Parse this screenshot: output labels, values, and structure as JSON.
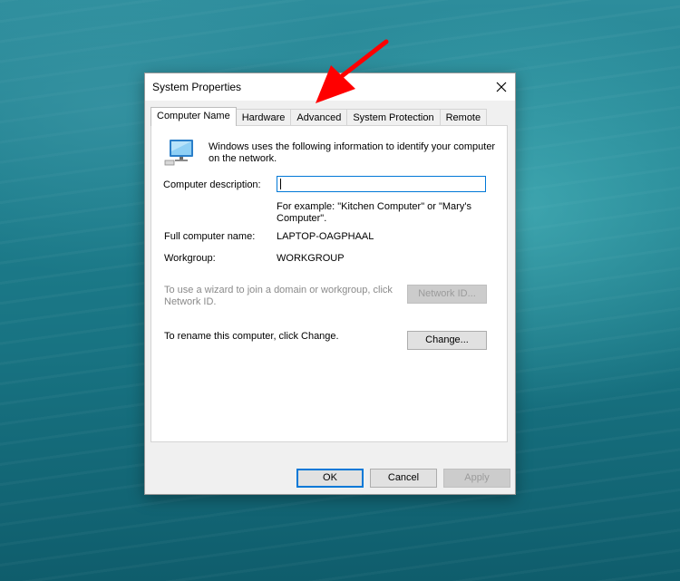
{
  "window": {
    "title": "System Properties"
  },
  "tabs": [
    {
      "label": "Computer Name",
      "active": true
    },
    {
      "label": "Hardware",
      "active": false
    },
    {
      "label": "Advanced",
      "active": false
    },
    {
      "label": "System Protection",
      "active": false
    },
    {
      "label": "Remote",
      "active": false
    }
  ],
  "computer_name_tab": {
    "intro_line1": "Windows uses the following information to identify your computer",
    "intro_line2": "on the network.",
    "description_label": "Computer description:",
    "description_value": "",
    "example_line1": "For example: \"Kitchen Computer\" or \"Mary's",
    "example_line2": "Computer\".",
    "full_name_label": "Full computer name:",
    "full_name_value": "LAPTOP-OAGPHAAL",
    "workgroup_label": "Workgroup:",
    "workgroup_value": "WORKGROUP",
    "wizard_line1": "To use a wizard to join a domain or workgroup, click",
    "wizard_line2": "Network ID.",
    "network_id_button": "Network ID...",
    "rename_text": "To rename this computer, click Change.",
    "change_button": "Change..."
  },
  "footer": {
    "ok": "OK",
    "cancel": "Cancel",
    "apply": "Apply"
  },
  "icons": {
    "close": "close-icon",
    "computer": "computer-icon",
    "annotation_arrow": "red-arrow-icon"
  },
  "colors": {
    "accent": "#0078d7",
    "annotation": "#ff0000",
    "dialog_bg": "#f0f0f0"
  }
}
